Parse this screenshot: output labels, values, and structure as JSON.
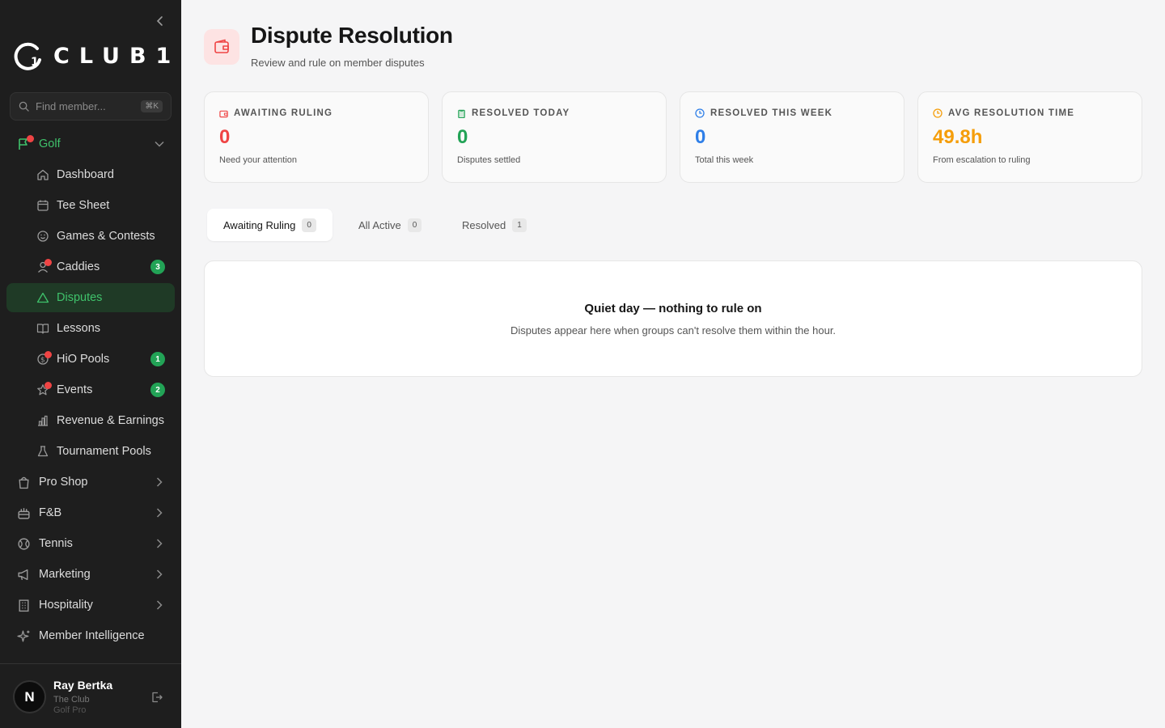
{
  "brand": {
    "logo_text": "CLUB1."
  },
  "search": {
    "placeholder": "Find member...",
    "shortcut": "⌘K"
  },
  "nav": {
    "golf_label": "Golf",
    "golf_items": [
      {
        "label": "Dashboard"
      },
      {
        "label": "Tee Sheet"
      },
      {
        "label": "Games & Contests"
      },
      {
        "label": "Caddies",
        "count": "3"
      },
      {
        "label": "Disputes"
      },
      {
        "label": "Lessons"
      },
      {
        "label": "HiO Pools",
        "count": "1"
      },
      {
        "label": "Events",
        "count": "2"
      },
      {
        "label": "Revenue & Earnings"
      },
      {
        "label": "Tournament Pools"
      }
    ],
    "sections": [
      {
        "label": "Pro Shop"
      },
      {
        "label": "F&B"
      },
      {
        "label": "Tennis"
      },
      {
        "label": "Marketing"
      },
      {
        "label": "Hospitality"
      },
      {
        "label": "Member Intelligence"
      }
    ]
  },
  "user": {
    "initial": "N",
    "name": "Ray Bertka",
    "club": "The Club",
    "role": "Golf Pro"
  },
  "header": {
    "title": "Dispute Resolution",
    "subtitle": "Review and rule on member disputes"
  },
  "stats": [
    {
      "label": "AWAITING RULING",
      "value": "0",
      "note": "Need your attention",
      "color": "#ef4444"
    },
    {
      "label": "RESOLVED TODAY",
      "value": "0",
      "note": "Disputes settled",
      "color": "#22a356"
    },
    {
      "label": "RESOLVED THIS WEEK",
      "value": "0",
      "note": "Total this week",
      "color": "#2f7fe8"
    },
    {
      "label": "AVG RESOLUTION TIME",
      "value": "49.8h",
      "note": "From escalation to ruling",
      "color": "#f59e0b"
    }
  ],
  "tabs": [
    {
      "label": "Awaiting Ruling",
      "count": "0"
    },
    {
      "label": "All Active",
      "count": "0"
    },
    {
      "label": "Resolved",
      "count": "1"
    }
  ],
  "empty": {
    "title": "Quiet day — nothing to rule on",
    "description": "Disputes appear here when groups can't resolve them within the hour."
  }
}
